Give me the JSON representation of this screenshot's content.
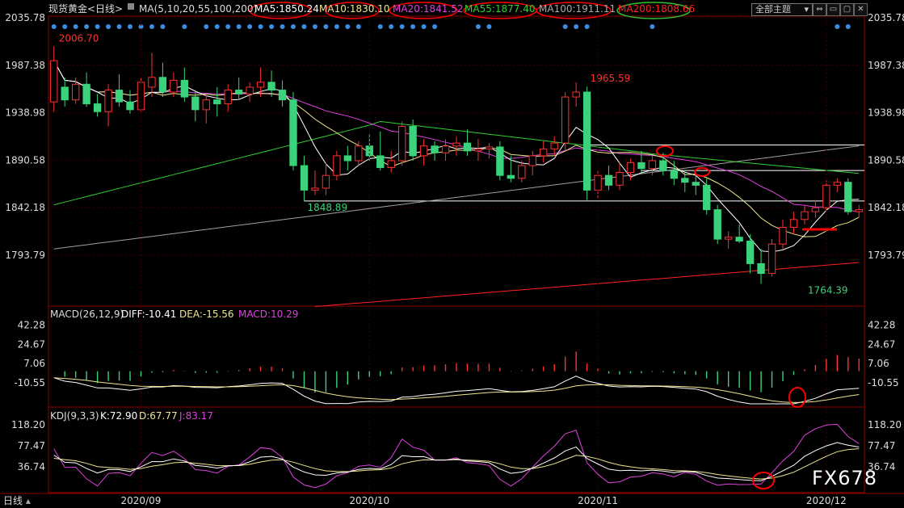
{
  "header": {
    "symbol": "现货黄金",
    "period_tag": "<日线>",
    "ma_params": "MA(5,10,20,55,100,200)",
    "ma5": "MA5:1850.24",
    "ma10": "MA10:1830.10",
    "ma20": "MA20:1841.52",
    "ma55": "MA55:1877.40",
    "ma100": "MA100:1911.11",
    "ma200": "MA200:1808.66",
    "theme_label": "全部主题",
    "colors": {
      "ma5": "#ffffff",
      "ma10": "#f0e68c",
      "ma20": "#e040e0",
      "ma55": "#30d030",
      "ma100": "#a0a0a0",
      "ma200": "#ff2020",
      "up": "#ff3030",
      "down": "#3ad27a"
    }
  },
  "footer": {
    "period_label": "日线",
    "watermark": "FX678"
  },
  "chart_data": [
    {
      "type": "candlestick",
      "name": "price",
      "y_ticks": [
        "2035.78",
        "1987.38",
        "1938.98",
        "1890.58",
        "1842.18",
        "1793.79"
      ],
      "ylim": [
        1745,
        2035.78
      ],
      "x_labels": [
        {
          "label": "2020/09",
          "index": 8
        },
        {
          "label": "2020/10",
          "index": 29
        },
        {
          "label": "2020/11",
          "index": 50
        },
        {
          "label": "2020/12",
          "index": 71
        }
      ],
      "annotations": [
        {
          "text": "2006.70",
          "index": 0,
          "value": 2006.7
        },
        {
          "text": "1965.59",
          "index": 49,
          "value": 1965.59
        },
        {
          "text": "1848.89",
          "index": 23,
          "value": 1848.89
        },
        {
          "text": "1764.39",
          "index": 69,
          "value": 1764.39
        }
      ],
      "candles": [
        [
          1950,
          2006.7,
          1940,
          1992
        ],
        [
          1965,
          1975,
          1945,
          1952
        ],
        [
          1952,
          1975,
          1948,
          1968
        ],
        [
          1968,
          1980,
          1945,
          1948
        ],
        [
          1948,
          1958,
          1935,
          1940
        ],
        [
          1940,
          1968,
          1925,
          1962
        ],
        [
          1962,
          1978,
          1945,
          1950
        ],
        [
          1950,
          1962,
          1938,
          1942
        ],
        [
          1942,
          1975,
          1940,
          1970
        ],
        [
          1965,
          2000,
          1955,
          1975
        ],
        [
          1975,
          1990,
          1955,
          1960
        ],
        [
          1960,
          1980,
          1955,
          1972
        ],
        [
          1972,
          1985,
          1950,
          1955
        ],
        [
          1955,
          1962,
          1930,
          1942
        ],
        [
          1942,
          1958,
          1928,
          1952
        ],
        [
          1952,
          1965,
          1935,
          1948
        ],
        [
          1948,
          1968,
          1940,
          1962
        ],
        [
          1962,
          1975,
          1952,
          1958
        ],
        [
          1958,
          1970,
          1950,
          1965
        ],
        [
          1965,
          1985,
          1955,
          1970
        ],
        [
          1970,
          1982,
          1955,
          1962
        ],
        [
          1962,
          1972,
          1945,
          1952
        ],
        [
          1952,
          1960,
          1880,
          1885
        ],
        [
          1885,
          1895,
          1848.89,
          1860
        ],
        [
          1860,
          1880,
          1855,
          1862
        ],
        [
          1862,
          1888,
          1855,
          1875
        ],
        [
          1875,
          1900,
          1870,
          1895
        ],
        [
          1895,
          1905,
          1880,
          1890
        ],
        [
          1890,
          1910,
          1885,
          1905
        ],
        [
          1905,
          1918,
          1890,
          1895
        ],
        [
          1895,
          1920,
          1880,
          1883
        ],
        [
          1883,
          1900,
          1878,
          1890
        ],
        [
          1890,
          1930,
          1885,
          1925
        ],
        [
          1925,
          1932,
          1890,
          1895
        ],
        [
          1895,
          1912,
          1885,
          1905
        ],
        [
          1905,
          1910,
          1890,
          1898
        ],
        [
          1898,
          1912,
          1890,
          1905
        ],
        [
          1905,
          1915,
          1895,
          1908
        ],
        [
          1908,
          1922,
          1895,
          1900
        ],
        [
          1900,
          1912,
          1890,
          1902
        ],
        [
          1902,
          1908,
          1892,
          1904
        ],
        [
          1904,
          1910,
          1870,
          1875
        ],
        [
          1875,
          1895,
          1868,
          1872
        ],
        [
          1872,
          1890,
          1868,
          1885
        ],
        [
          1885,
          1900,
          1875,
          1895
        ],
        [
          1895,
          1910,
          1888,
          1902
        ],
        [
          1902,
          1915,
          1895,
          1908
        ],
        [
          1908,
          1960,
          1900,
          1955
        ],
        [
          1955,
          1970,
          1945,
          1960
        ],
        [
          1960,
          1965.59,
          1850,
          1860
        ],
        [
          1860,
          1880,
          1852,
          1875
        ],
        [
          1875,
          1885,
          1860,
          1865
        ],
        [
          1865,
          1888,
          1860,
          1878
        ],
        [
          1878,
          1892,
          1870,
          1888
        ],
        [
          1888,
          1900,
          1878,
          1882
        ],
        [
          1882,
          1895,
          1875,
          1890
        ],
        [
          1890,
          1898,
          1875,
          1880
        ],
        [
          1880,
          1890,
          1865,
          1872
        ],
        [
          1872,
          1880,
          1858,
          1868
        ],
        [
          1868,
          1878,
          1855,
          1865
        ],
        [
          1865,
          1872,
          1835,
          1840
        ],
        [
          1840,
          1845,
          1805,
          1810
        ],
        [
          1810,
          1818,
          1800,
          1812
        ],
        [
          1812,
          1825,
          1806,
          1808
        ],
        [
          1808,
          1815,
          1775,
          1785
        ],
        [
          1785,
          1800,
          1764.39,
          1775
        ],
        [
          1775,
          1810,
          1772,
          1805
        ],
        [
          1805,
          1830,
          1800,
          1822
        ],
        [
          1822,
          1838,
          1815,
          1830
        ],
        [
          1830,
          1845,
          1825,
          1838
        ],
        [
          1838,
          1850,
          1832,
          1842
        ],
        [
          1842,
          1870,
          1838,
          1865
        ],
        [
          1865,
          1872,
          1858,
          1868
        ],
        [
          1868,
          1872,
          1835,
          1838
        ],
        [
          1838,
          1845,
          1832,
          1840
        ]
      ],
      "reference_lines": [
        1906,
        1880,
        1848.89
      ]
    },
    {
      "type": "bar+line",
      "name": "MACD(26,12,9)",
      "legend": [
        "MACD(26,12,9)",
        "DIFF:-10.41",
        "DEA:-15.56",
        "MACD:10.29"
      ],
      "y_ticks": [
        "42.28",
        "24.67",
        "7.06",
        "-10.55"
      ],
      "ylim": [
        -30,
        48
      ]
    },
    {
      "type": "line",
      "name": "KDJ(9,3,3)",
      "legend": [
        "KDJ(9,3,3)",
        "K:72.90",
        "D:67.77",
        "J:83.17"
      ],
      "y_ticks": [
        "118.20",
        "77.47",
        "36.74"
      ],
      "ylim": [
        -10,
        135
      ]
    }
  ]
}
